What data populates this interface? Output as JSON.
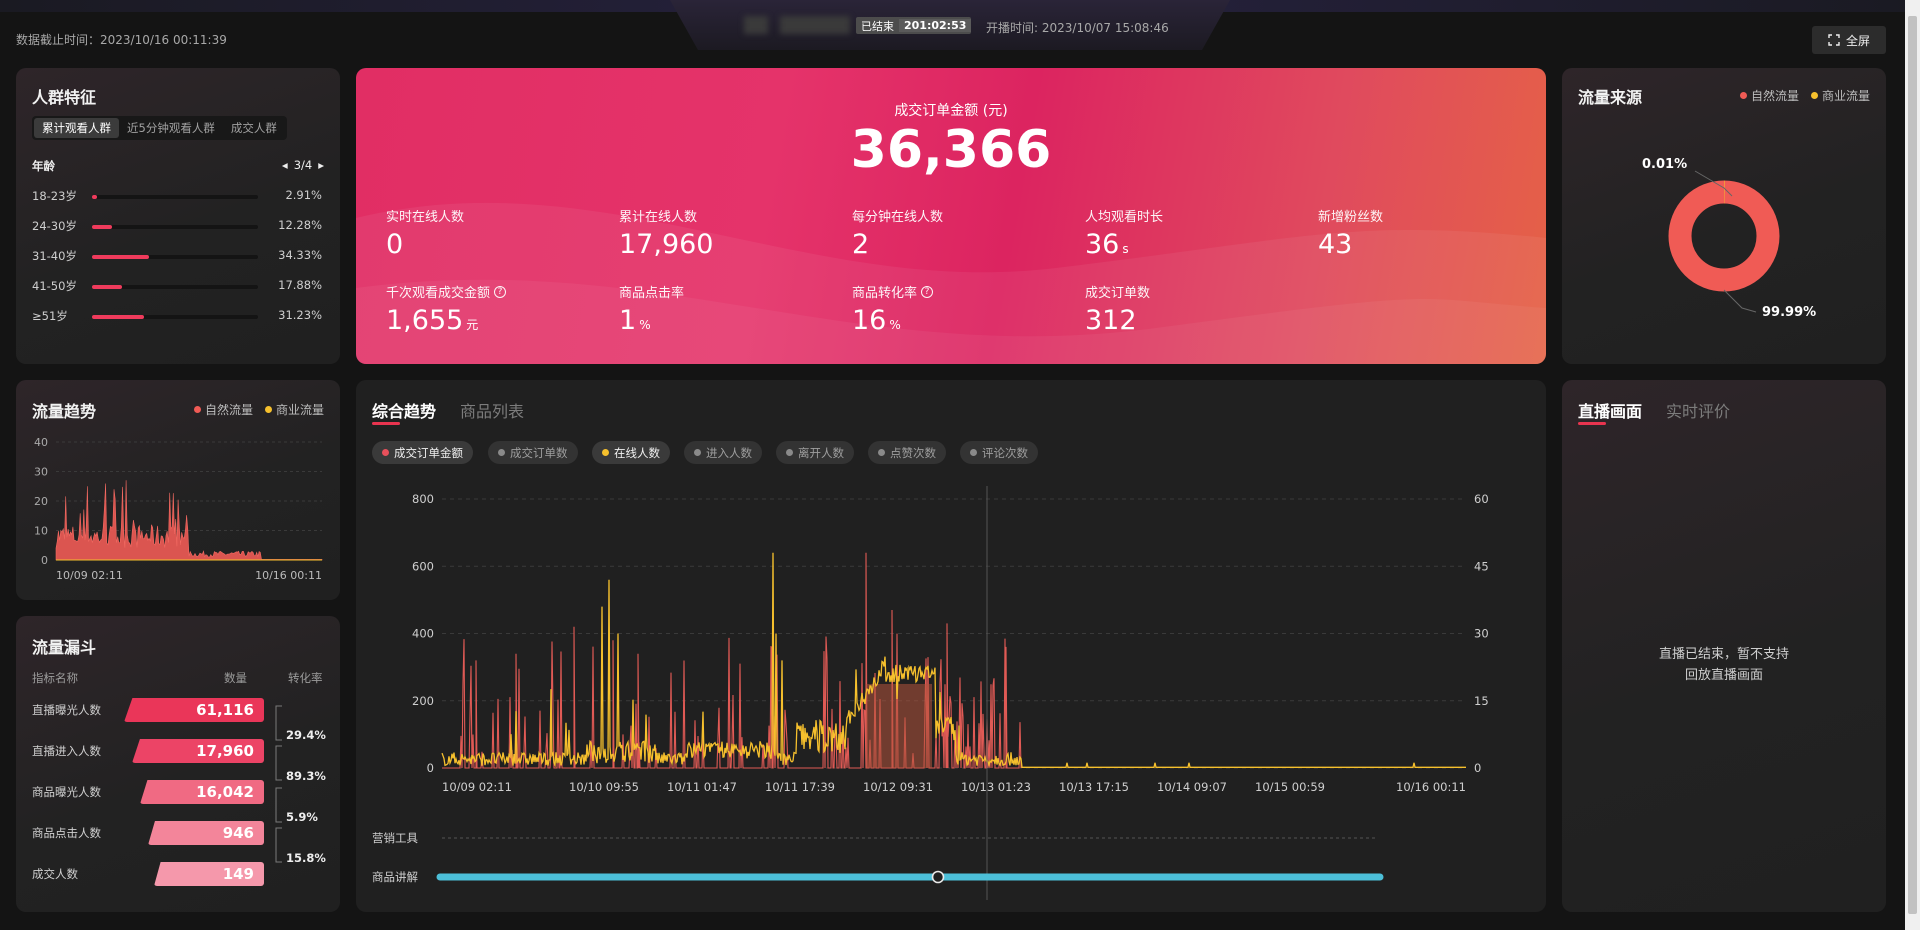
{
  "header": {
    "data_cutoff": "数据截止时间：2023/10/16 00:11:39",
    "status": "已结束",
    "duration": "201:02:53",
    "start_time": "开播时间: 2023/10/07 15:08:46",
    "fullscreen": "全屏"
  },
  "crowd": {
    "title": "人群特征",
    "tabs": [
      "累计观看人群",
      "近5分钟观看人群",
      "成交人群"
    ],
    "section": "年龄",
    "page": "3/4",
    "rows": [
      {
        "label": "18-23岁",
        "pct": "2.91%",
        "value": 2.91
      },
      {
        "label": "24-30岁",
        "pct": "12.28%",
        "value": 12.28
      },
      {
        "label": "31-40岁",
        "pct": "34.33%",
        "value": 34.33
      },
      {
        "label": "41-50岁",
        "pct": "17.88%",
        "value": 17.88
      },
      {
        "label": "≥51岁",
        "pct": "31.23%",
        "value": 31.23
      }
    ]
  },
  "hero": {
    "main_label": "成交订单金额 (元)",
    "main_value": "36,366",
    "metrics": [
      {
        "label": "实时在线人数",
        "value": "0",
        "unit": "",
        "help": false
      },
      {
        "label": "累计在线人数",
        "value": "17,960",
        "unit": "",
        "help": false
      },
      {
        "label": "每分钟在线人数",
        "value": "2",
        "unit": "",
        "help": false
      },
      {
        "label": "人均观看时长",
        "value": "36",
        "unit": "s",
        "help": false
      },
      {
        "label": "新增粉丝数",
        "value": "43",
        "unit": "",
        "help": false
      },
      {
        "label": "千次观看成交金额",
        "value": "1,655",
        "unit": "元",
        "help": true
      },
      {
        "label": "商品点击率",
        "value": "1",
        "unit": "%",
        "help": false
      },
      {
        "label": "商品转化率",
        "value": "16",
        "unit": "%",
        "help": true
      },
      {
        "label": "成交订单数",
        "value": "312",
        "unit": "",
        "help": false
      }
    ]
  },
  "traffic_source": {
    "title": "流量来源",
    "legend": [
      "自然流量",
      "商业流量"
    ],
    "slices": [
      {
        "name": "自然流量",
        "label": "99.99%",
        "value": 99.99
      },
      {
        "name": "商业流量",
        "label": "0.01%",
        "value": 0.01
      }
    ]
  },
  "traffic_trend": {
    "title": "流量趋势",
    "legend": [
      "自然流量",
      "商业流量"
    ],
    "y_ticks": [
      "40",
      "30",
      "20",
      "10",
      "0"
    ],
    "x_ticks": [
      "10/09 02:11",
      "10/16 00:11"
    ]
  },
  "funnel": {
    "title": "流量漏斗",
    "headers": [
      "指标名称",
      "数量",
      "转化率"
    ],
    "rows": [
      {
        "label": "直播曝光人数",
        "value": "61,116"
      },
      {
        "label": "直播进入人数",
        "value": "17,960"
      },
      {
        "label": "商品曝光人数",
        "value": "16,042"
      },
      {
        "label": "商品点击人数",
        "value": "946"
      },
      {
        "label": "成交人数",
        "value": "149"
      }
    ],
    "conversions": [
      "29.4%",
      "89.3%",
      "5.9%",
      "15.8%"
    ]
  },
  "main_chart": {
    "tabs": [
      "综合趋势",
      "商品列表"
    ],
    "pills": [
      {
        "label": "成交订单金额",
        "on": true,
        "color": "#e8505b"
      },
      {
        "label": "成交订单数",
        "on": false,
        "color": "#8a8a8a"
      },
      {
        "label": "在线人数",
        "on": true,
        "color": "#f6c02d"
      },
      {
        "label": "进入人数",
        "on": false,
        "color": "#8a8a8a"
      },
      {
        "label": "离开人数",
        "on": false,
        "color": "#8a8a8a"
      },
      {
        "label": "点赞次数",
        "on": false,
        "color": "#8a8a8a"
      },
      {
        "label": "评论次数",
        "on": false,
        "color": "#8a8a8a"
      }
    ],
    "y_left": [
      "800",
      "600",
      "400",
      "200",
      "0"
    ],
    "y_right": [
      "60",
      "45",
      "30",
      "15",
      "0"
    ],
    "x_ticks": [
      "10/09 02:11",
      "10/10 09:55",
      "10/11 01:47",
      "10/11 17:39",
      "10/12 09:31",
      "10/13 01:23",
      "10/13 17:15",
      "10/14 09:07",
      "10/15 00:59",
      "10/16 00:11"
    ],
    "rows": [
      "营销工具",
      "商品讲解"
    ]
  },
  "live_view": {
    "tabs": [
      "直播画面",
      "实时评价"
    ],
    "message_1": "直播已结束，暂不支持",
    "message_2": "回放直播画面"
  },
  "chart_data": [
    {
      "type": "line",
      "title": "综合趋势",
      "x_range": [
        "10/09 02:11",
        "10/16 00:11"
      ],
      "series": [
        {
          "name": "成交订单金额",
          "axis": "left",
          "ylim": [
            0,
            800
          ],
          "peaks": [
            {
              "x": "10/10 09:55",
              "y": 500
            },
            {
              "x": "10/11 17:39",
              "y": 640
            },
            {
              "x": "10/12 09:31",
              "y": 380
            }
          ]
        },
        {
          "name": "在线人数",
          "axis": "right",
          "ylim": [
            0,
            60
          ],
          "peaks": [
            {
              "x": "10/10 09:55",
              "y": 42
            },
            {
              "x": "10/11 01:47",
              "y": 48
            },
            {
              "x": "10/11 17:39",
              "y": 23
            }
          ]
        }
      ]
    },
    {
      "type": "pie",
      "title": "流量来源",
      "categories": [
        "自然流量",
        "商业流量"
      ],
      "values": [
        99.99,
        0.01
      ]
    },
    {
      "type": "area",
      "title": "流量趋势",
      "ylim": [
        0,
        40
      ],
      "x_range": [
        "10/09 02:11",
        "10/16 00:11"
      ]
    }
  ]
}
